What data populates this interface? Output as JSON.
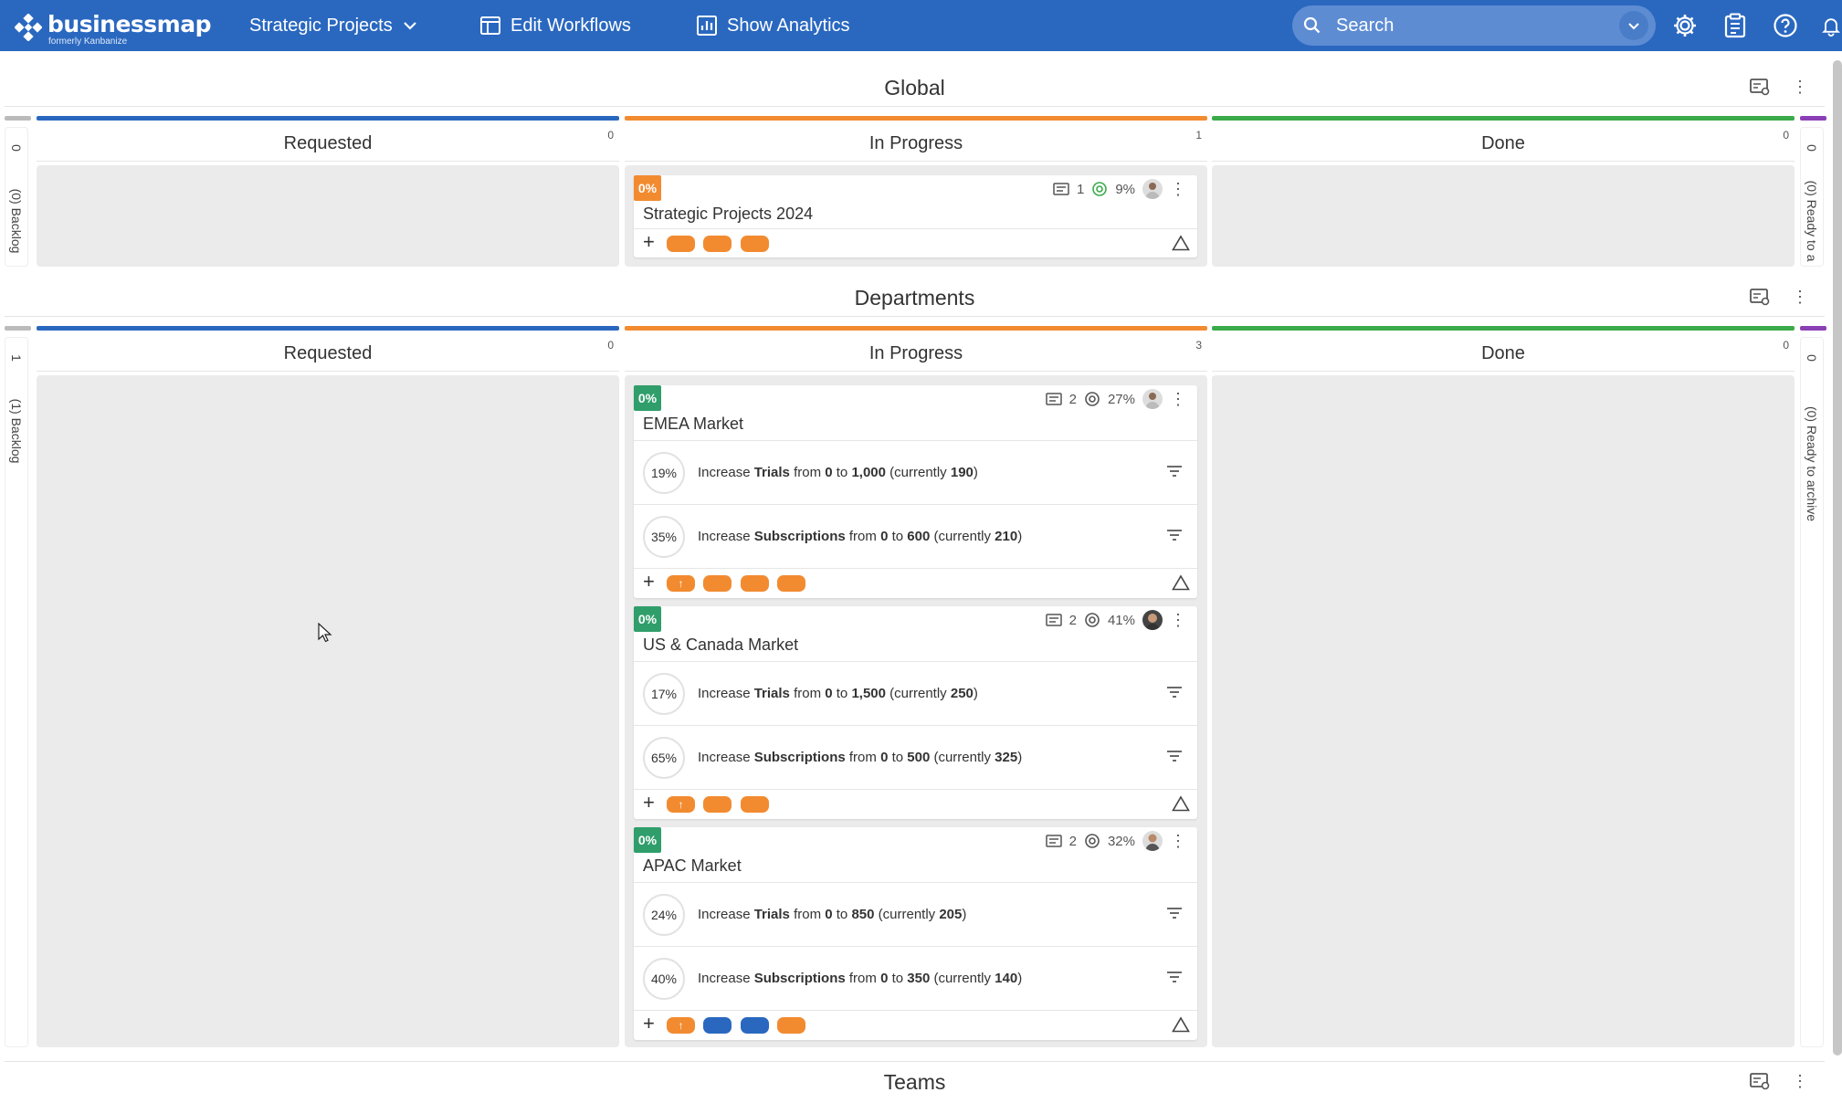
{
  "brand": {
    "name": "businessmap",
    "sub": "formerly Kanbanize"
  },
  "nav": {
    "board_selector": "Strategic Projects",
    "edit_workflows": "Edit Workflows",
    "show_analytics": "Show Analytics"
  },
  "search": {
    "placeholder": "Search"
  },
  "colors": {
    "topbar": "#2a68c0",
    "requested": "#2a68c0",
    "in_progress": "#f28b30",
    "done": "#3aaa4a",
    "archive": "#8a3fb5",
    "badge_orange": "#f28b30",
    "badge_green": "#2f9e6b"
  },
  "sections": {
    "global": {
      "title": "Global",
      "left_count": "0",
      "left_label": "(0) Backlog",
      "right_count": "0",
      "right_label": "(0) Ready to a",
      "columns": [
        {
          "label": "Requested",
          "count": "0"
        },
        {
          "label": "In Progress",
          "count": "1"
        },
        {
          "label": "Done",
          "count": "0"
        }
      ],
      "card": {
        "badge": "0%",
        "comments": "1",
        "progress": "9%",
        "title": "Strategic Projects 2024"
      }
    },
    "departments": {
      "title": "Departments",
      "left_count": "1",
      "left_label": "(1) Backlog",
      "right_count": "0",
      "right_label": "(0) Ready to archive",
      "columns": [
        {
          "label": "Requested",
          "count": "0"
        },
        {
          "label": "In Progress",
          "count": "3"
        },
        {
          "label": "Done",
          "count": "0"
        }
      ],
      "cards": [
        {
          "badge": "0%",
          "comments": "2",
          "progress": "27%",
          "title": "EMEA Market",
          "krs": [
            {
              "pct": "19%",
              "pre": "Increase ",
              "metric": "Trials",
              "from_w": " from ",
              "from": "0",
              "to_w": " to ",
              "to": "1,000",
              "cur_pre": " (currently ",
              "cur": "190",
              "cur_post": ")"
            },
            {
              "pct": "35%",
              "pre": "Increase ",
              "metric": "Subscriptions",
              "from_w": " from ",
              "from": "0",
              "to_w": " to ",
              "to": "600",
              "cur_pre": " (currently ",
              "cur": "210",
              "cur_post": ")"
            }
          ]
        },
        {
          "badge": "0%",
          "comments": "2",
          "progress": "41%",
          "title": "US & Canada Market",
          "krs": [
            {
              "pct": "17%",
              "pre": "Increase ",
              "metric": "Trials",
              "from_w": " from ",
              "from": "0",
              "to_w": " to ",
              "to": "1,500",
              "cur_pre": " (currently ",
              "cur": "250",
              "cur_post": ")"
            },
            {
              "pct": "65%",
              "pre": "Increase ",
              "metric": "Subscriptions",
              "from_w": " from ",
              "from": "0",
              "to_w": " to ",
              "to": "500",
              "cur_pre": " (currently ",
              "cur": "325",
              "cur_post": ")"
            }
          ]
        },
        {
          "badge": "0%",
          "comments": "2",
          "progress": "32%",
          "title": "APAC Market",
          "krs": [
            {
              "pct": "24%",
              "pre": "Increase ",
              "metric": "Trials",
              "from_w": " from ",
              "from": "0",
              "to_w": " to ",
              "to": "850",
              "cur_pre": " (currently ",
              "cur": "205",
              "cur_post": ")"
            },
            {
              "pct": "40%",
              "pre": "Increase ",
              "metric": "Subscriptions",
              "from_w": " from ",
              "from": "0",
              "to_w": " to ",
              "to": "350",
              "cur_pre": " (currently ",
              "cur": "140",
              "cur_post": ")"
            }
          ]
        }
      ]
    },
    "teams": {
      "title": "Teams"
    }
  }
}
